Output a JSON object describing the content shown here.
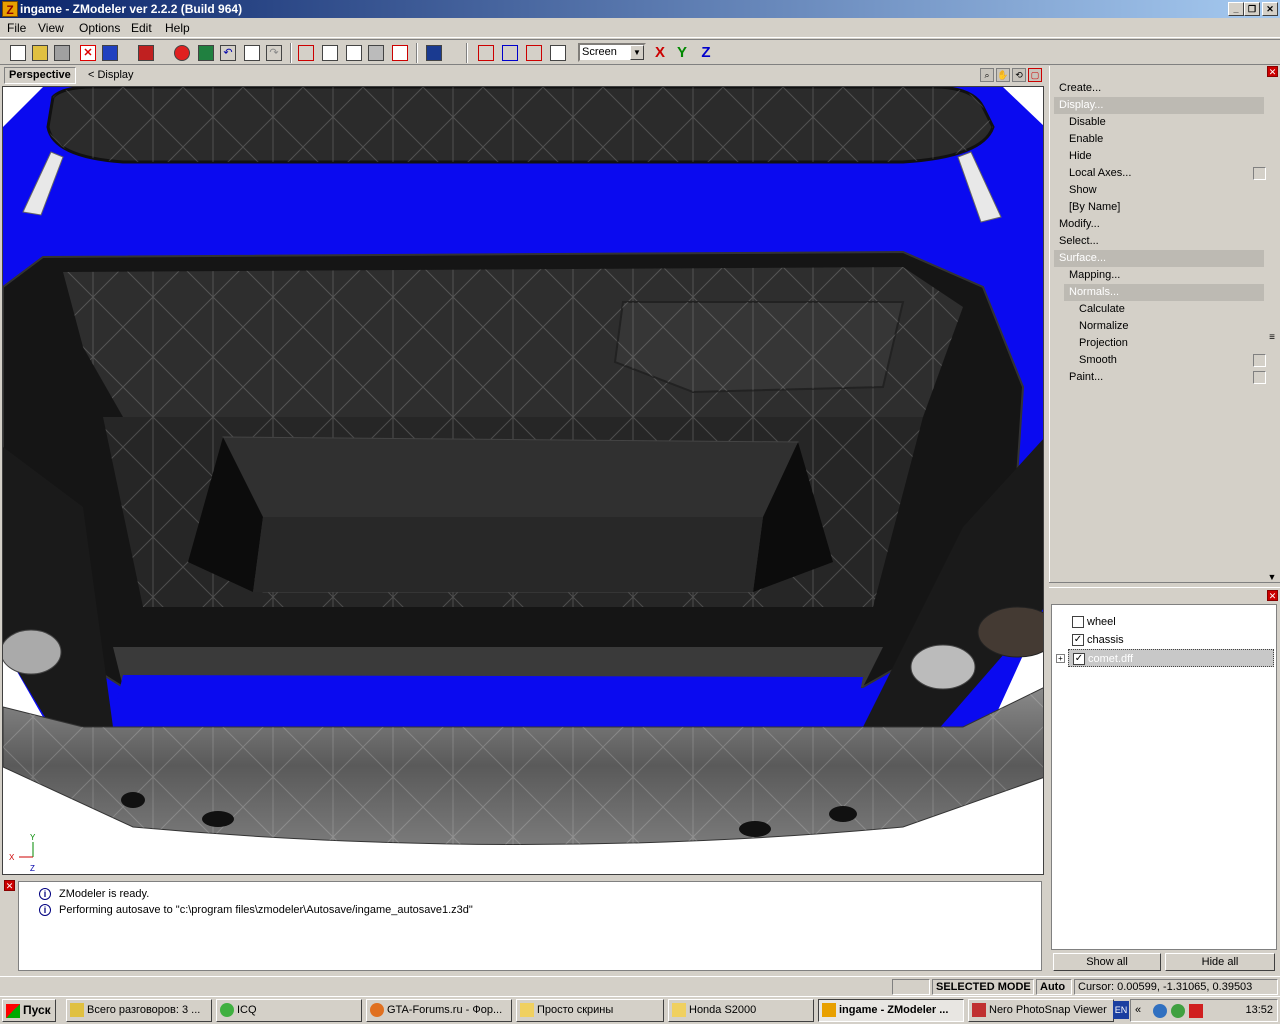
{
  "window": {
    "title": "ingame - ZModeler ver 2.2.2 (Build 964)",
    "app_icon_letter": "Z"
  },
  "menubar": {
    "items": [
      "File",
      "View",
      "Options",
      "Edit",
      "Help"
    ]
  },
  "toolbar": {
    "coord_mode": "Screen",
    "axis_x": "X",
    "axis_y": "Y",
    "axis_z": "Z"
  },
  "viewport": {
    "view_name": "Perspective",
    "breadcrumb": "< Display",
    "gizmo": {
      "y": "Y",
      "x": "X",
      "z": "Z"
    }
  },
  "command_panel": {
    "items": [
      {
        "label": "Create...",
        "level": 0,
        "header": false,
        "check": false
      },
      {
        "label": "Display...",
        "level": 0,
        "header": true,
        "check": false
      },
      {
        "label": "Disable",
        "level": 1,
        "header": false,
        "check": false
      },
      {
        "label": "Enable",
        "level": 1,
        "header": false,
        "check": false
      },
      {
        "label": "Hide",
        "level": 1,
        "header": false,
        "check": false
      },
      {
        "label": "Local Axes...",
        "level": 1,
        "header": false,
        "check": true
      },
      {
        "label": "Show",
        "level": 1,
        "header": false,
        "check": false
      },
      {
        "label": "[By Name]",
        "level": 1,
        "header": false,
        "check": false
      },
      {
        "label": "Modify...",
        "level": 0,
        "header": false,
        "check": false
      },
      {
        "label": "Select...",
        "level": 0,
        "header": false,
        "check": false
      },
      {
        "label": "Surface...",
        "level": 0,
        "header": true,
        "check": false
      },
      {
        "label": "Mapping...",
        "level": 1,
        "header": false,
        "check": false
      },
      {
        "label": "Normals...",
        "level": 1,
        "header": true,
        "check": false
      },
      {
        "label": "Calculate",
        "level": 2,
        "header": false,
        "check": false
      },
      {
        "label": "Normalize",
        "level": 2,
        "header": false,
        "check": false
      },
      {
        "label": "Projection",
        "level": 2,
        "header": false,
        "check": false
      },
      {
        "label": "Smooth",
        "level": 2,
        "header": false,
        "check": true
      },
      {
        "label": "Paint...",
        "level": 1,
        "header": false,
        "check": true
      }
    ]
  },
  "object_tree": {
    "nodes": [
      {
        "label": "wheel",
        "checked": false
      },
      {
        "label": "chassis",
        "checked": true
      },
      {
        "label": "comet.dff",
        "checked": true
      }
    ],
    "show_all": "Show all",
    "hide_all": "Hide all"
  },
  "log": {
    "lines": [
      "ZModeler is ready.",
      "Performing autosave to \"c:\\program files\\zmodeler\\Autosave/ingame_autosave1.z3d\""
    ]
  },
  "statusbar": {
    "mode": "SELECTED MODE",
    "auto": "Auto",
    "cursor": "Cursor: 0.00599, -1.31065, 0.39503"
  },
  "taskbar": {
    "start": "Пуск",
    "tasks": [
      "Всего разговоров: 3 ...",
      "ICQ",
      "GTA-Forums.ru - Фор...",
      "Просто скрины",
      "Honda S2000",
      "ingame - ZModeler ...",
      "Nero PhotoSnap Viewer"
    ],
    "lang": "EN",
    "clock": "13:52"
  },
  "colors": {
    "titlebar": "#0a246a",
    "body_blue": "#0a0af0",
    "trunk_dark": "#2a2a2a",
    "bumper": "#6e6e6e"
  }
}
